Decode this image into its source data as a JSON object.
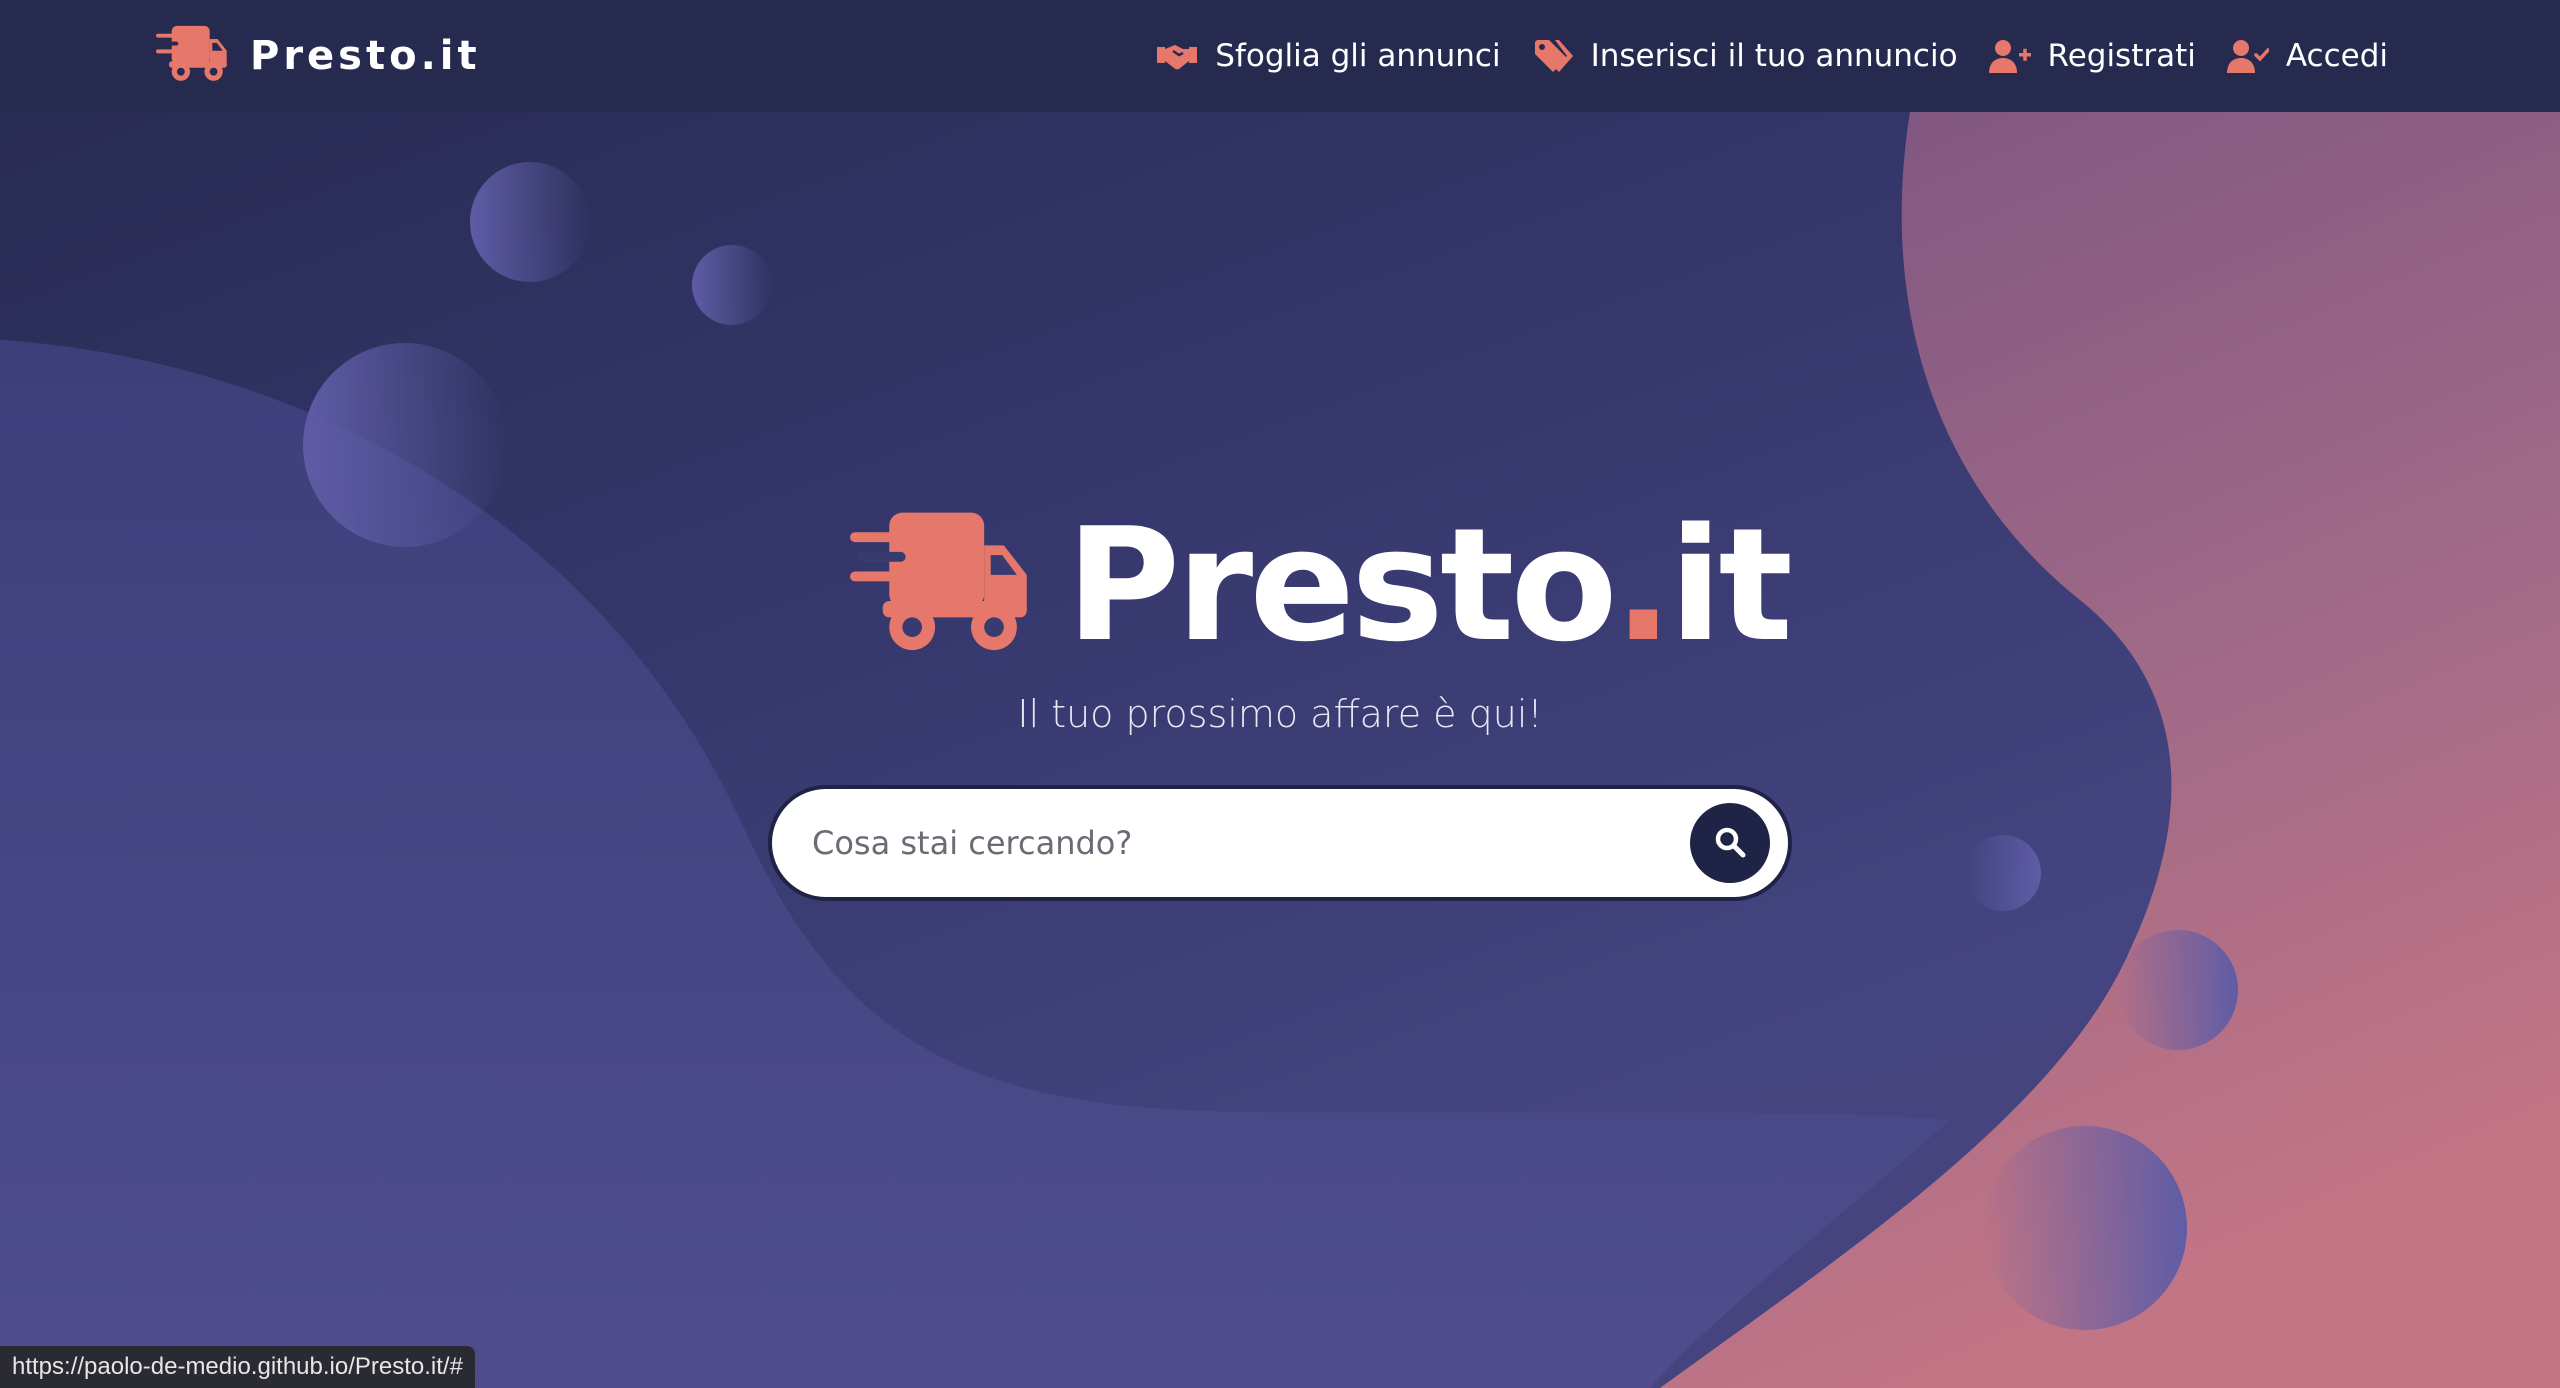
{
  "brand": {
    "name": "Presto.it",
    "icon": "truck-fast-icon"
  },
  "nav": {
    "items": [
      {
        "label": "Sfoglia gli annunci",
        "icon": "handshake-icon"
      },
      {
        "label": "Inserisci il tuo annuncio",
        "icon": "tags-icon"
      },
      {
        "label": "Registrati",
        "icon": "user-plus-icon"
      },
      {
        "label": "Accedi",
        "icon": "user-check-icon"
      }
    ]
  },
  "hero": {
    "title_main": "Presto",
    "title_dot": ".",
    "title_tld": "it",
    "tagline": "Il tuo prossimo affare è qui!",
    "search_placeholder": "Cosa stai cercando?",
    "search_icon": "search-icon"
  },
  "status_bar": {
    "url": "https://paolo-de-medio.github.io/Presto.it/#"
  },
  "colors": {
    "accent": "#e5786a",
    "navbar": "#262a4f",
    "search_button": "#1f2346",
    "background": "#34366a"
  }
}
